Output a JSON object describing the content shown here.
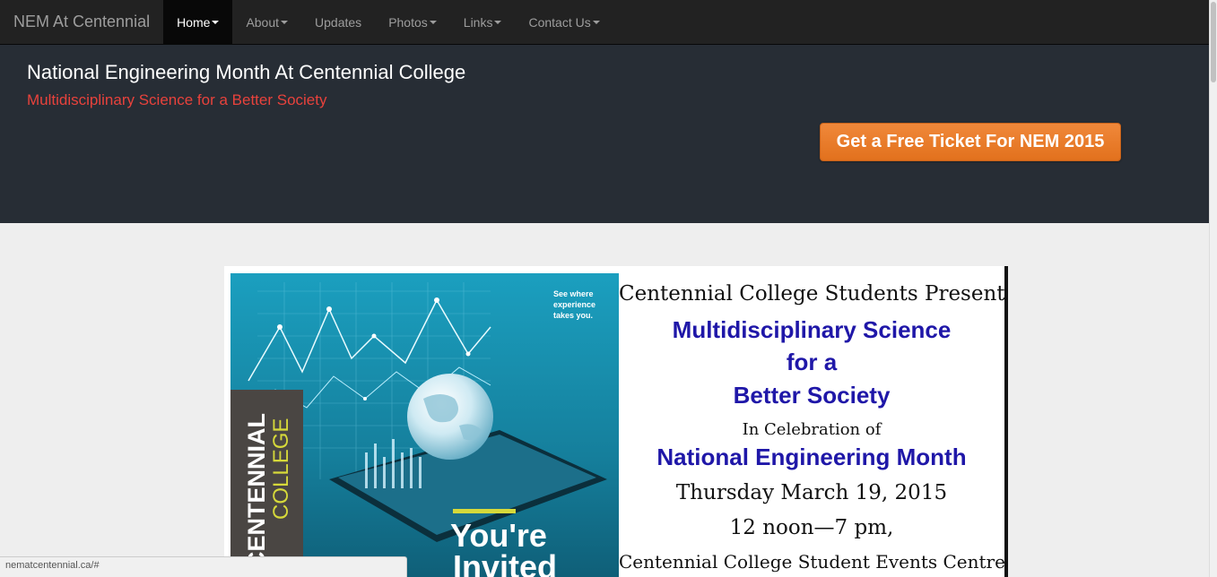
{
  "nav": {
    "brand": "NEM At Centennial",
    "items": [
      {
        "label": "Home",
        "dropdown": true,
        "active": true
      },
      {
        "label": "About",
        "dropdown": true,
        "active": false
      },
      {
        "label": "Updates",
        "dropdown": false,
        "active": false
      },
      {
        "label": "Photos",
        "dropdown": true,
        "active": false
      },
      {
        "label": "Links",
        "dropdown": true,
        "active": false
      },
      {
        "label": "Contact Us",
        "dropdown": true,
        "active": false
      }
    ]
  },
  "jumbotron": {
    "title": "National Engineering Month At Centennial College",
    "subtitle": "Multidisciplinary Science for a Better Society",
    "button_label": "Get a Free Ticket For NEM 2015"
  },
  "flyer": {
    "poster": {
      "tagline_1": "See where",
      "tagline_2": "experience",
      "tagline_3": "takes you.",
      "brand_1": "CENTENNIAL",
      "brand_2": "COLLEGE",
      "invite_1": "You're",
      "invite_2": "Invited"
    },
    "line_1": "Centennial College Students Present",
    "line_2": "Multidisciplinary Science",
    "line_3": "for a",
    "line_4": "Better Society",
    "line_5": "In Celebration of",
    "line_6": "National Engineering Month",
    "line_7": "Thursday March 19, 2015",
    "line_8": "12 noon—7 pm,",
    "line_9": "Centennial College Student Events Centre"
  },
  "status_url": "nematcentennial.ca/#",
  "colors": {
    "navbar_bg": "#222222",
    "jumbotron_bg": "#272d35",
    "subtitle_red": "#e8423c",
    "button_orange": "#e97d2a",
    "flyer_blue": "#1f17a8",
    "poster_teal": "#1aa3c4",
    "college_yellow": "#d6d93a"
  }
}
